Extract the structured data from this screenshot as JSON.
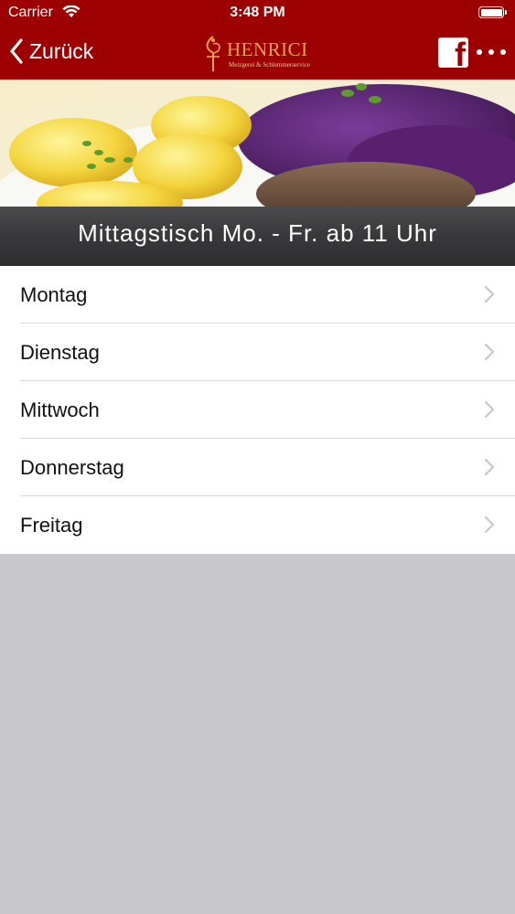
{
  "status_bar": {
    "carrier": "Carrier",
    "time": "3:48 PM"
  },
  "nav": {
    "back_label": "Zurück",
    "logo_title": "HENRICI",
    "logo_subtitle": "Metzgerei & Schlemmerservice",
    "facebook_label": "f"
  },
  "hero": {
    "title": "Mittagstisch Mo. - Fr. ab 11 Uhr"
  },
  "days": [
    {
      "label": "Montag"
    },
    {
      "label": "Dienstag"
    },
    {
      "label": "Mittwoch"
    },
    {
      "label": "Donnerstag"
    },
    {
      "label": "Freitag"
    }
  ],
  "colors": {
    "brand": "#9d0000",
    "logo_gold": "#e9a24a",
    "background": "#c8c7cc"
  },
  "icons": [
    "wifi-icon",
    "battery-icon",
    "back-chevron-icon",
    "facebook-icon",
    "more-icon",
    "chevron-right-icon"
  ]
}
